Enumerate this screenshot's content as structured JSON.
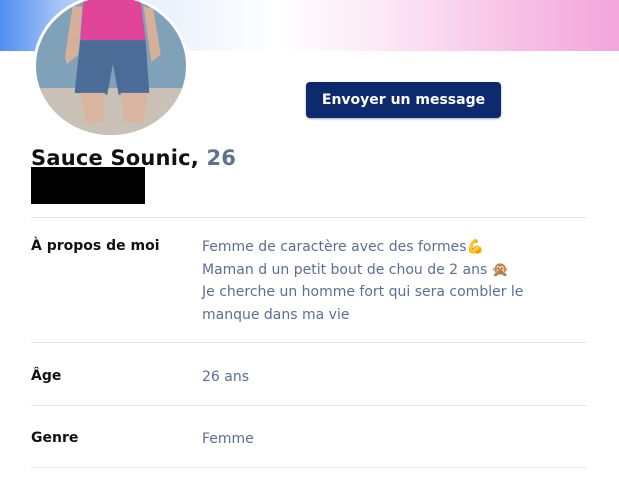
{
  "profile": {
    "name": "Sauce Sounic,",
    "age": "26",
    "message_button": "Envoyer un message"
  },
  "details": {
    "about": {
      "label": "À propos de moi",
      "lines": [
        "Femme de caractère avec des formes",
        "Maman d un petit bout de chou de 2 ans",
        "Je cherche un homme fort qui sera combler  le",
        "manque dans ma vie"
      ],
      "emoji_1": "💪",
      "emoji_2": "🙊"
    },
    "age": {
      "label": "Âge",
      "value": "26 ans"
    },
    "gender": {
      "label": "Genre",
      "value": "Femme"
    }
  },
  "colors": {
    "button_bg": "#0d2a6e",
    "value_text": "#5b6f93",
    "age_text": "#5d7290"
  }
}
